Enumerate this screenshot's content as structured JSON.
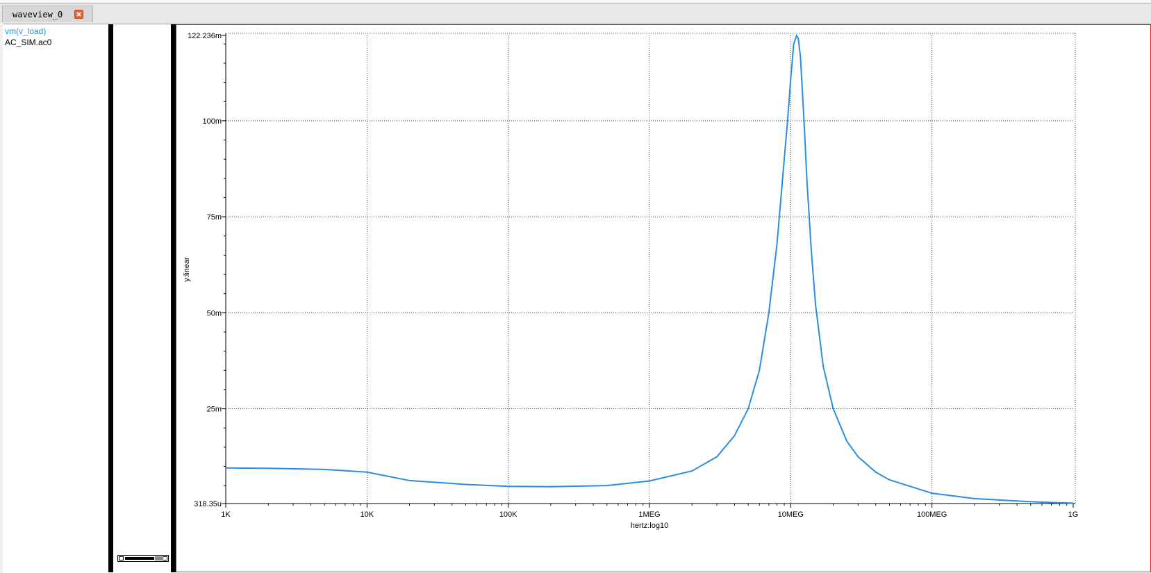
{
  "window": {
    "tab_label": "waveview_0"
  },
  "signals": {
    "name": "vm(v_load)",
    "source": "AC_SIM.ac0"
  },
  "colors": {
    "curve": "#2a8de0",
    "frame": "#e02020",
    "signal_name": "#2a8bd6"
  },
  "chart_data": {
    "type": "line",
    "xlabel": "hertz:log10",
    "ylabel": "y:linear",
    "xscale": "log",
    "xlim": [
      1000,
      1000000000
    ],
    "ylim": [
      0.00031835,
      0.122236
    ],
    "xtick_labels": [
      "1K",
      "10K",
      "100K",
      "1MEG",
      "10MEG",
      "100MEG",
      "1G"
    ],
    "xtick_values": [
      1000,
      10000,
      100000,
      1000000,
      10000000,
      100000000,
      1000000000
    ],
    "ytick_labels": [
      "318.35u",
      "25m",
      "50m",
      "75m",
      "100m",
      "122.236m"
    ],
    "ytick_values": [
      0.00031835,
      0.025,
      0.05,
      0.075,
      0.1,
      0.122236
    ],
    "grid": true,
    "series": [
      {
        "name": "vm(v_load)",
        "x": [
          1000,
          2000,
          5000,
          10000,
          20000,
          50000,
          100000,
          200000,
          500000,
          1000000,
          2000000,
          3000000,
          4000000,
          5000000,
          6000000,
          7000000,
          8000000,
          9000000,
          9500000,
          10000000,
          10500000,
          11000000,
          11300000,
          11700000,
          12000000,
          12500000,
          13000000,
          14000000,
          15000000,
          17000000,
          20000000,
          25000000,
          30000000,
          40000000,
          50000000,
          100000000,
          200000000,
          500000000,
          1000000000
        ],
        "y": [
          0.0096,
          0.0095,
          0.0092,
          0.0085,
          0.0063,
          0.0053,
          0.0048,
          0.0047,
          0.005,
          0.0062,
          0.0088,
          0.0125,
          0.018,
          0.025,
          0.035,
          0.05,
          0.068,
          0.09,
          0.1,
          0.111,
          0.12,
          0.1222,
          0.1215,
          0.117,
          0.11,
          0.098,
          0.085,
          0.066,
          0.052,
          0.036,
          0.025,
          0.0165,
          0.0125,
          0.0085,
          0.0065,
          0.003,
          0.0016,
          0.0008,
          0.0004
        ]
      }
    ]
  }
}
